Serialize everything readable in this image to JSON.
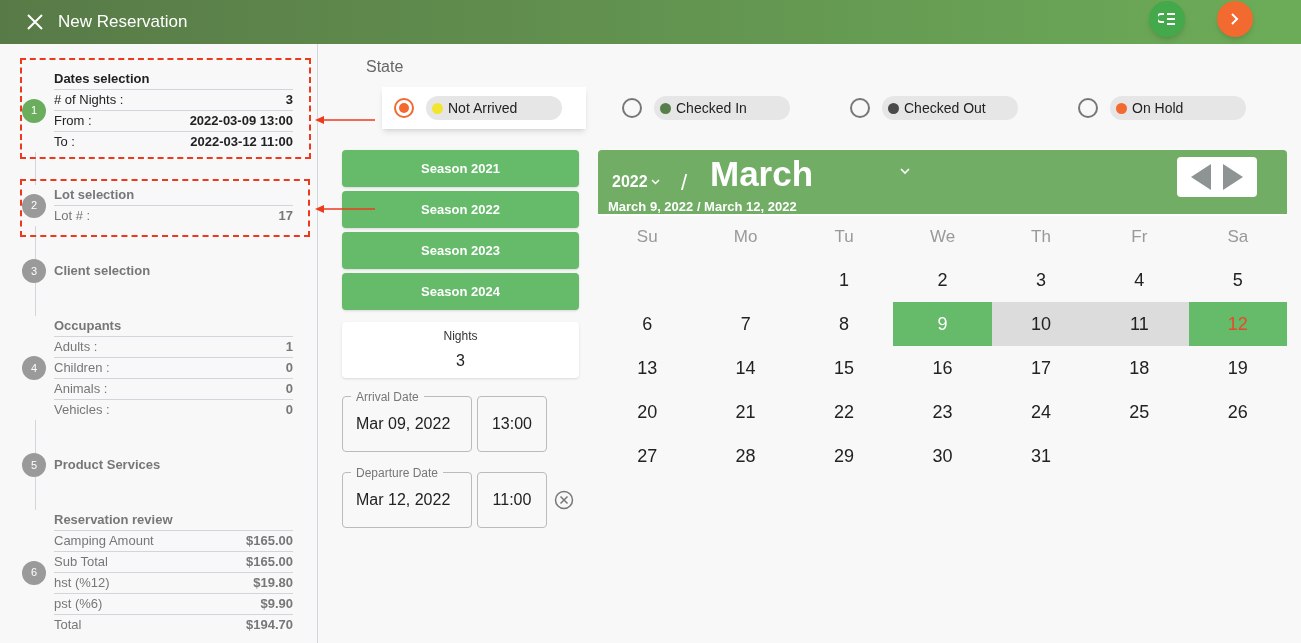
{
  "window": {
    "title": "New Reservation"
  },
  "steps": [
    {
      "number": "1",
      "title": "Dates selection",
      "active": true,
      "rows": [
        {
          "label": "# of Nights :",
          "value": "3"
        },
        {
          "label": "From :",
          "value": "2022-03-09 13:00"
        },
        {
          "label": "To :",
          "value": "2022-03-12 11:00"
        }
      ]
    },
    {
      "number": "2",
      "title": "Lot selection",
      "active": false,
      "rows": [
        {
          "label": "Lot # :",
          "value": "17"
        }
      ]
    },
    {
      "number": "3",
      "title": "Client selection",
      "active": false
    },
    {
      "number": "4",
      "title": "Occupants",
      "active": false,
      "rows": [
        {
          "label": "Adults :",
          "value": "1"
        },
        {
          "label": "Children :",
          "value": "0"
        },
        {
          "label": "Animals :",
          "value": "0"
        },
        {
          "label": "Vehicles :",
          "value": "0"
        }
      ]
    },
    {
      "number": "5",
      "title": "Product Services",
      "active": false
    },
    {
      "number": "6",
      "title": "Reservation review",
      "active": false,
      "rows": [
        {
          "label": "Camping Amount",
          "value": "$165.00"
        },
        {
          "label": "Sub Total",
          "value": "$165.00"
        },
        {
          "label": "hst (%12)",
          "value": "$19.80"
        },
        {
          "label": "pst (%6)",
          "value": "$9.90"
        },
        {
          "label": "Total",
          "value": "$194.70"
        }
      ]
    }
  ],
  "state": {
    "label": "State",
    "options": [
      {
        "label": "Not Arrived",
        "color": "#f2e530",
        "selected": true
      },
      {
        "label": "Checked In",
        "color": "#587f4b",
        "selected": false
      },
      {
        "label": "Checked Out",
        "color": "#4a4a4a",
        "selected": false
      },
      {
        "label": "On Hold",
        "color": "#f26a30",
        "selected": false
      }
    ]
  },
  "seasons": [
    "Season 2021",
    "Season 2022",
    "Season 2023",
    "Season 2024"
  ],
  "nights": {
    "label": "Nights",
    "value": "3"
  },
  "arrival": {
    "label": "Arrival Date",
    "date": "Mar 09, 2022",
    "time": "13:00"
  },
  "departure": {
    "label": "Departure Date",
    "date": "Mar 12, 2022",
    "time": "11:00"
  },
  "calendar": {
    "year": "2022",
    "separator": "/",
    "month": "March",
    "range": "March 9, 2022 / March 12, 2022",
    "weekdays": [
      "Su",
      "Mo",
      "Tu",
      "We",
      "Th",
      "Fr",
      "Sa"
    ],
    "weeks": [
      {
        "kind": "leading",
        "days": [
          {
            "day": "1",
            "kind": "plain"
          },
          {
            "day": "2",
            "kind": "plain"
          },
          {
            "day": "3",
            "kind": "plain"
          },
          {
            "day": "4",
            "kind": "plain"
          },
          {
            "day": "5",
            "kind": "plain"
          }
        ]
      },
      {
        "kind": "full",
        "days": [
          {
            "day": "6",
            "kind": "plain"
          },
          {
            "day": "7",
            "kind": "plain"
          },
          {
            "day": "8",
            "kind": "plain"
          },
          {
            "day": "9",
            "kind": "start"
          },
          {
            "day": "10",
            "kind": "middle"
          },
          {
            "day": "11",
            "kind": "middle"
          },
          {
            "day": "12",
            "kind": "end"
          }
        ]
      },
      {
        "kind": "full",
        "days": [
          {
            "day": "13",
            "kind": "plain"
          },
          {
            "day": "14",
            "kind": "plain"
          },
          {
            "day": "15",
            "kind": "plain"
          },
          {
            "day": "16",
            "kind": "plain"
          },
          {
            "day": "17",
            "kind": "plain"
          },
          {
            "day": "18",
            "kind": "plain"
          },
          {
            "day": "19",
            "kind": "plain"
          }
        ]
      },
      {
        "kind": "full",
        "days": [
          {
            "day": "20",
            "kind": "plain"
          },
          {
            "day": "21",
            "kind": "plain"
          },
          {
            "day": "22",
            "kind": "plain"
          },
          {
            "day": "23",
            "kind": "plain"
          },
          {
            "day": "24",
            "kind": "plain"
          },
          {
            "day": "25",
            "kind": "plain"
          },
          {
            "day": "26",
            "kind": "plain"
          }
        ]
      },
      {
        "kind": "trailing",
        "days": [
          {
            "day": "27",
            "kind": "plain"
          },
          {
            "day": "28",
            "kind": "plain"
          },
          {
            "day": "29",
            "kind": "plain"
          },
          {
            "day": "30",
            "kind": "plain"
          },
          {
            "day": "31",
            "kind": "plain"
          }
        ]
      }
    ]
  }
}
